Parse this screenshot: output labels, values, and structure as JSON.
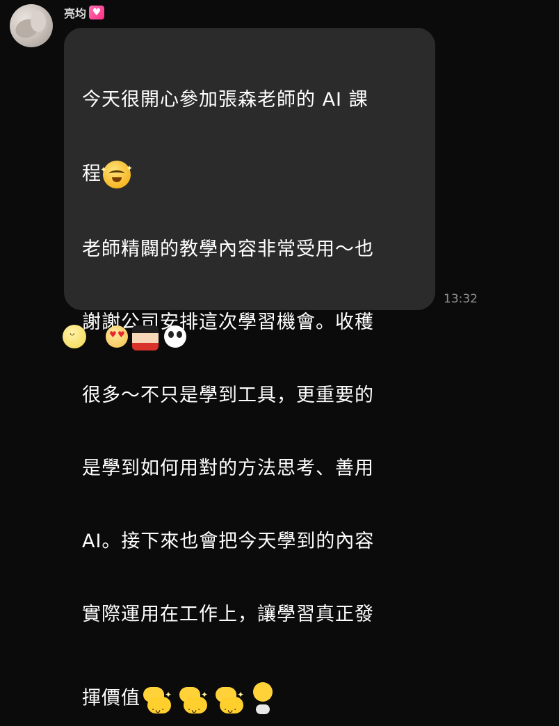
{
  "chat": {
    "sender_name": "亮均",
    "sender_badge_icon": "sparkle-heart-icon",
    "message_lines": [
      "今天很開心參加張森老師的 AI 課",
      "程",
      "老師精闢的教學內容非常受用～也",
      "謝謝公司安排這次學習機會。收穫",
      "很多～不只是學到工具，更重要的",
      "是學到如何用對的方法思考、善用",
      "AI。接下來也會把今天學到的內容",
      "實際運用在工作上，讓學習真正發",
      "揮價值"
    ],
    "inline_emojis": [
      "crying-happy-emoji-icon",
      "flexing-arm-emoji-icon",
      "flexing-arm-emoji-icon",
      "flexing-arm-emoji-icon",
      "determined-fire-emoji-icon"
    ],
    "timestamp": "13:32"
  },
  "reactions": {
    "add_reaction_icon": "smile-icon",
    "items": [
      "love-eyes-sticker-icon",
      "crayon-boy-sticker-icon",
      "thumbs-up-panda-sticker-icon"
    ]
  }
}
